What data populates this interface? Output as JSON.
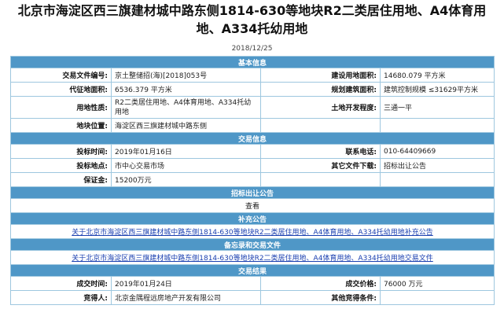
{
  "page": {
    "title_line1": "北京市海淀区西三旗建材城中路东侧1814-630等地块R2二类居住用地、A4体育用",
    "title_line2": "地、A334托幼用地",
    "date": "2018/12/25"
  },
  "basic": {
    "header": "基本信息",
    "doc_no_label": "交易文件编号:",
    "doc_no_value": "京土整储招(海)[2018]053号",
    "construction_area_label": "建设用地面积:",
    "construction_area_value": "14680.079 平方米",
    "agent_area_label": "代征地面积:",
    "agent_area_value": "6536.379 平方米",
    "planned_area_label": "规划建筑面积:",
    "planned_area_value": "建筑控制规模 ≤31629平方米",
    "land_use_label": "用地性质:",
    "land_use_value": "R2二类居住用地、A4体育用地、A334托幼用地",
    "dev_level_label": "土地开发程度:",
    "dev_level_value": "三通一平",
    "location_label": "地块位置:",
    "location_value": "海淀区西三旗建材城中路东侧"
  },
  "trade": {
    "header": "交易信息",
    "bid_time_label": "投标时间:",
    "bid_time_value": "2019年01月16日",
    "phone_label": "联系电话:",
    "phone_value": "010-64409669",
    "bid_place_label": "投标地点:",
    "bid_place_value": "市中心交易市场",
    "other_docs_label": "其它文件下载:",
    "other_docs_value": "招标出让公告",
    "deposit_label": "保证金:",
    "deposit_value": "15200万元"
  },
  "notice": {
    "header": "招标出让公告",
    "view_label": "查看"
  },
  "supplement": {
    "header": "补充公告",
    "link": "关于北京市海淀区西三旗建材城中路东侧1814-630等地块R2二类居住用地、A4体育用地、A334托幼用地补充公告"
  },
  "filing": {
    "header": "备忘录和交易文件",
    "link": "关于北京市海淀区西三旗建材城中路东侧1814-630等地块R2二类居住用地、A4体育用地、A334托幼用地交易文件"
  },
  "result": {
    "header": "交易结果",
    "deal_time_label": "成交时间:",
    "deal_time_value": "2019年01月24日",
    "deal_price_label": "成交价格:",
    "deal_price_value": "76000 万元",
    "bidder_label": "竞得人:",
    "bidder_value": "北京金隅程远房地产开发有限公司",
    "other_conditions_label": "其他竞得条件:",
    "other_conditions_value": ""
  },
  "colors": {
    "section_header_bg": "#4f97c7",
    "border": "#9ec7df",
    "link": "#1a3fb0"
  }
}
